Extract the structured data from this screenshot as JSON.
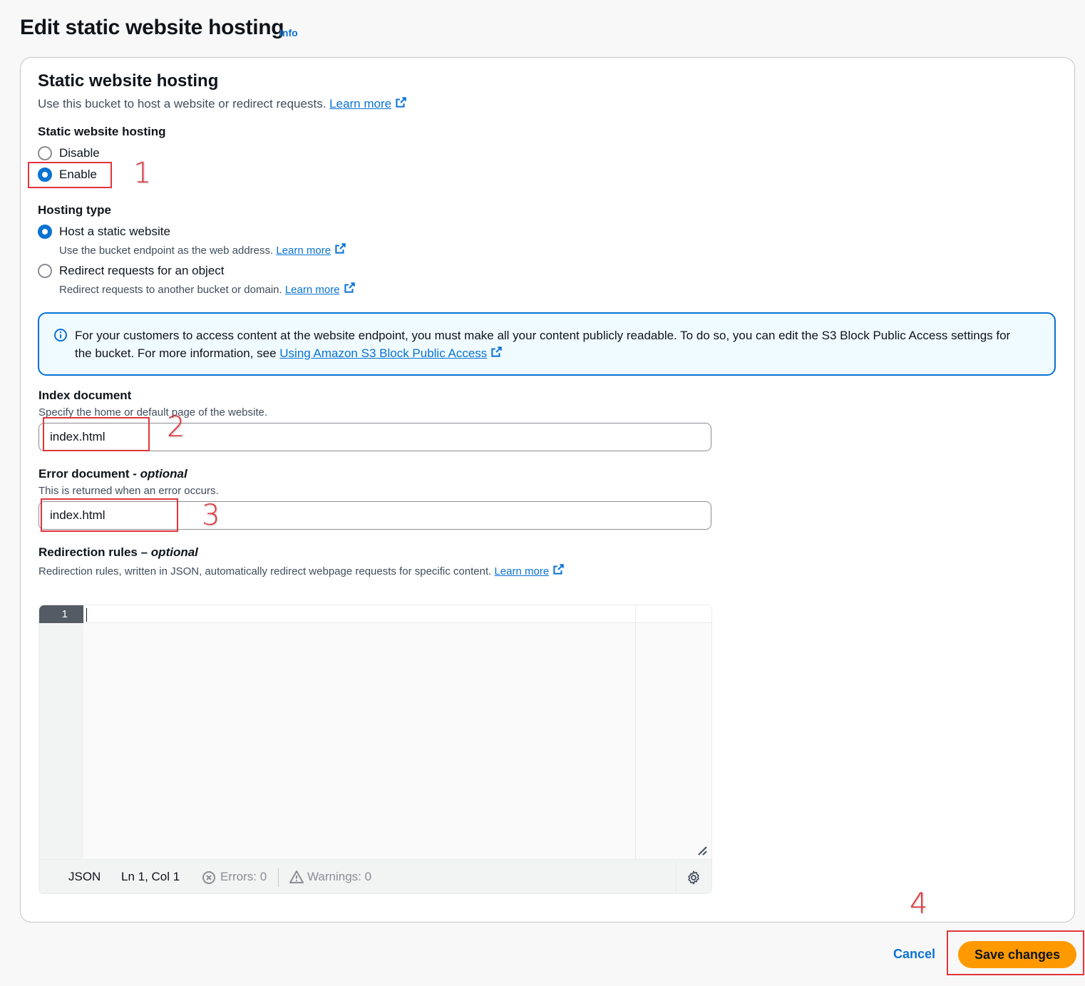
{
  "page": {
    "title": "Edit static website hosting",
    "info": "Info"
  },
  "section": {
    "title": "Static website hosting",
    "description": "Use this bucket to host a website or redirect requests.",
    "learn_more": "Learn more"
  },
  "hosting": {
    "label": "Static website hosting",
    "options": [
      "Disable",
      "Enable"
    ],
    "selected": "Enable"
  },
  "hosting_type": {
    "label": "Hosting type",
    "options": [
      {
        "label": "Host a static website",
        "desc": "Use the bucket endpoint as the web address.",
        "link": "Learn more"
      },
      {
        "label": "Redirect requests for an object",
        "desc": "Redirect requests to another bucket or domain.",
        "link": "Learn more"
      }
    ],
    "selected": "Host a static website"
  },
  "alert": {
    "text": "For your customers to access content at the website endpoint, you must make all your content publicly readable. To do so, you can edit the S3 Block Public Access settings for the bucket. For more information, see",
    "link": "Using Amazon S3 Block Public Access"
  },
  "index_document": {
    "label": "Index document",
    "desc": "Specify the home or default page of the website.",
    "value": "index.html"
  },
  "error_document": {
    "label": "Error document",
    "optional": "optional",
    "desc": "This is returned when an error occurs.",
    "value": "index.html"
  },
  "redirection_rules": {
    "label": "Redirection rules –",
    "optional": "optional",
    "desc": "Redirection rules, written in JSON, automatically redirect webpage requests for specific content.",
    "link": "Learn more"
  },
  "editor": {
    "line_number": "1",
    "mode": "JSON",
    "position": "Ln 1, Col 1",
    "errors": "Errors: 0",
    "warnings": "Warnings: 0"
  },
  "annotations": [
    "1",
    "2",
    "3",
    "4"
  ],
  "footer": {
    "cancel": "Cancel",
    "save": "Save changes"
  },
  "colors": {
    "accent": "#0972d3",
    "primary_button": "#ff9900",
    "annotation": "#e0353b"
  }
}
